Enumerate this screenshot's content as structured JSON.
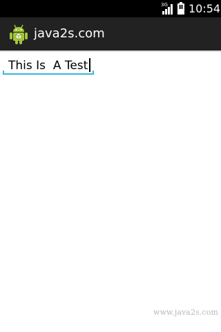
{
  "status_bar": {
    "network": "3G",
    "time": "10:54",
    "icons": [
      "signal-icon",
      "battery-icon"
    ]
  },
  "action_bar": {
    "title": "java2s.com",
    "icon": "android-icon"
  },
  "edit_text": {
    "value": "This Is  A Test",
    "accent_color": "#33b5e5"
  },
  "watermark": {
    "text": "www.java2s.com"
  }
}
